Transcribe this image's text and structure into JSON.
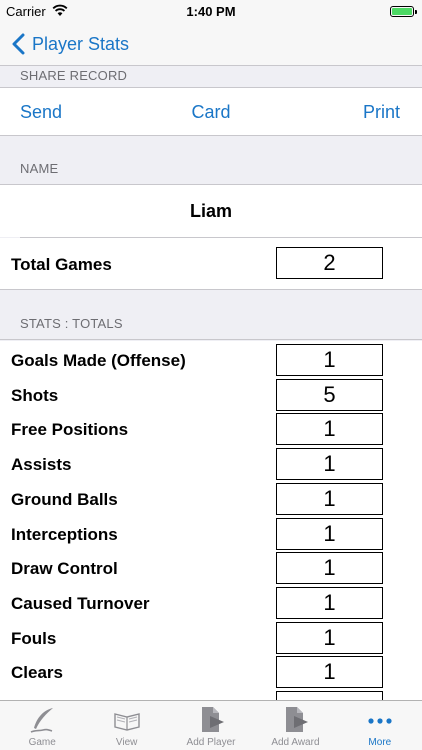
{
  "status_bar": {
    "carrier": "Carrier",
    "time": "1:40 PM"
  },
  "nav": {
    "back_label": "Player Stats"
  },
  "share": {
    "header": "SHARE RECORD",
    "send_label": "Send",
    "card_label": "Card",
    "print_label": "Print"
  },
  "name_section": {
    "header": "NAME",
    "value": "Liam"
  },
  "total_games": {
    "label": "Total Games",
    "value": "2"
  },
  "stats": {
    "header": "STATS : TOTALS",
    "rows": [
      {
        "label": "Goals Made (Offense)",
        "value": "1"
      },
      {
        "label": "Shots",
        "value": "5"
      },
      {
        "label": "Free Positions",
        "value": "1"
      },
      {
        "label": "Assists",
        "value": "1"
      },
      {
        "label": "Ground Balls",
        "value": "1"
      },
      {
        "label": "Interceptions",
        "value": "1"
      },
      {
        "label": "Draw Control",
        "value": "1"
      },
      {
        "label": "Caused Turnover",
        "value": "1"
      },
      {
        "label": "Fouls",
        "value": "1"
      },
      {
        "label": "Clears",
        "value": "1"
      }
    ]
  },
  "tab_bar": {
    "tabs": [
      {
        "label": "Game",
        "icon": "quill-icon",
        "active": false
      },
      {
        "label": "View",
        "icon": "book-icon",
        "active": false
      },
      {
        "label": "Add Player",
        "icon": "document-arrow-icon",
        "active": false
      },
      {
        "label": "Add Award",
        "icon": "document-arrow-icon",
        "active": false
      },
      {
        "label": "More",
        "icon": "more-dots-icon",
        "active": true
      }
    ]
  },
  "colors": {
    "accent": "#1a76c7",
    "battery": "#4cd964",
    "background": "#efeff4"
  }
}
